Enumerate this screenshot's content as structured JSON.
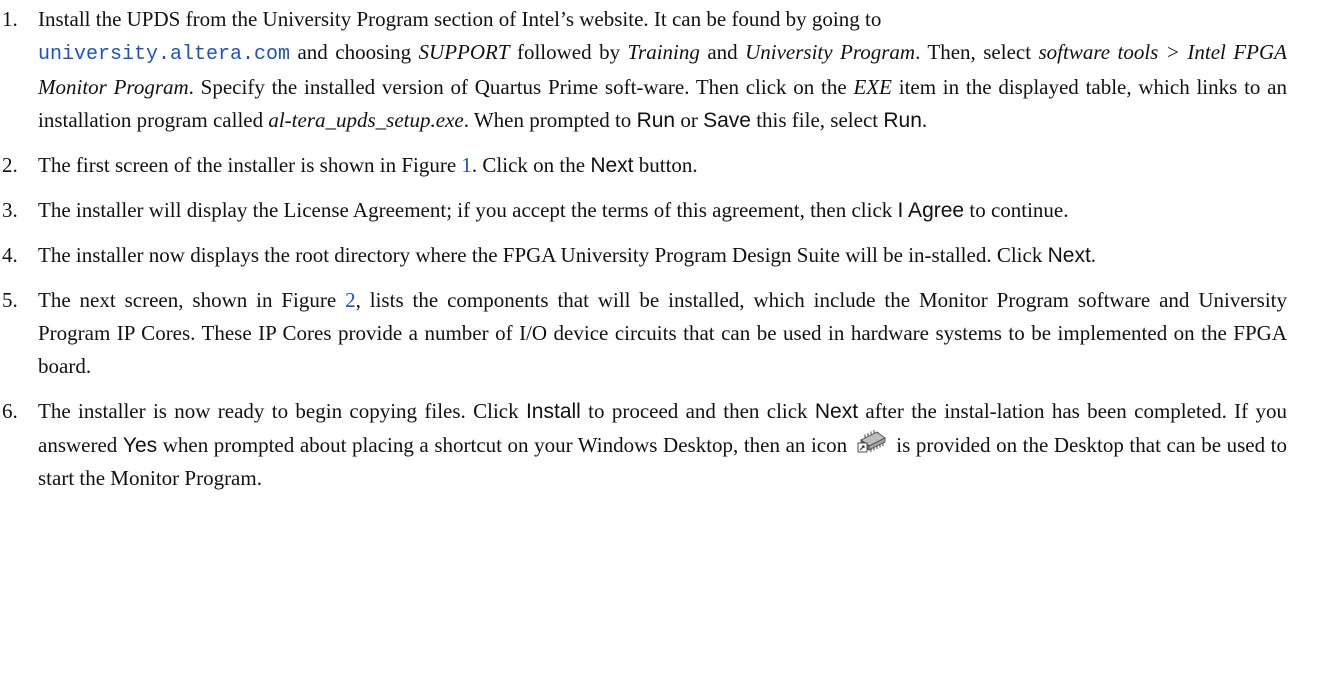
{
  "steps": [
    {
      "num": "1.",
      "parts": {
        "a": "Install the UPDS from the University Program section of Intel’s website. It can be found by going to",
        "link": "university.altera.com",
        "b": " and choosing ",
        "support": "SUPPORT",
        "c": " followed by ",
        "training": "Training",
        "d": " and ",
        "univ_prog": "University Program",
        "e": ". Then, select ",
        "software_tools": "software tools > Intel FPGA Monitor Program",
        "f": ". Specify the installed version of Quartus Prime soft-ware. Then click on the ",
        "exe": "EXE",
        "g": " item in the displayed table, which links to an installation program called ",
        "setup_file": "al-tera_upds_setup.exe",
        "h": ". When prompted to ",
        "run1": "Run",
        "i": " or ",
        "save": "Save",
        "j": " this file, select ",
        "run2": "Run",
        "k": "."
      }
    },
    {
      "num": "2.",
      "parts": {
        "a": "The first screen of the installer is shown in Figure ",
        "fig": "1",
        "b": ". Click on the ",
        "btn": "Next",
        "c": " button."
      }
    },
    {
      "num": "3.",
      "parts": {
        "a": "The installer will display the License Agreement; if you accept the terms of this agreement, then click ",
        "btn": "I Agree",
        "b": " to continue."
      }
    },
    {
      "num": "4.",
      "parts": {
        "a": "The installer now displays the root directory where the FPGA University Program Design Suite will be in-stalled. Click ",
        "btn": "Next",
        "b": "."
      }
    },
    {
      "num": "5.",
      "parts": {
        "a": "The next screen, shown in Figure ",
        "fig": "2",
        "b": ", lists the components that will be installed, which include the Monitor Program software and University Program IP Cores. These IP Cores provide a number of I/O device circuits that can be used in hardware systems to be implemented on the FPGA board."
      }
    },
    {
      "num": "6.",
      "parts": {
        "a": "The installer is now ready to begin copying files. Click ",
        "install": "Install",
        "b": " to proceed and then click ",
        "next": "Next",
        "c": " after the instal-lation has been completed. If you answered ",
        "yes": "Yes",
        "d": " when prompted about placing a shortcut on your Windows Desktop, then an icon ",
        "e": " is provided on the Desktop that can be used to start the Monitor Program."
      }
    }
  ],
  "colors": {
    "link": "#1a4fd6",
    "text": "#111111"
  },
  "icons": {
    "monitor_program": "monitor-program-chip-icon"
  }
}
